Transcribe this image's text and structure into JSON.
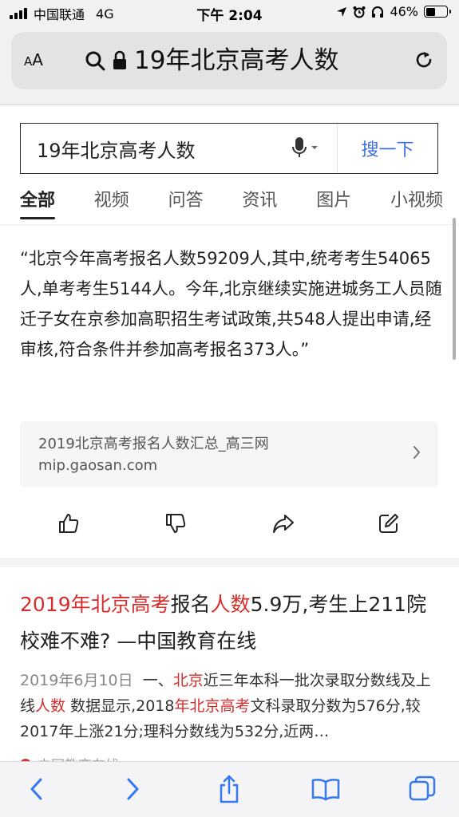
{
  "status_bar": {
    "carrier": "中国联通",
    "network": "4G",
    "time": "下午 2:04",
    "battery_percent": "46%",
    "battery_level": 0.46
  },
  "browser": {
    "text_size_label": "AA",
    "url_text": "19年北京高考人数",
    "icons": [
      "search-icon",
      "lock-icon",
      "reload-icon"
    ]
  },
  "search": {
    "query": "19年北京高考人数",
    "button_label": "搜一下"
  },
  "tabs": [
    {
      "label": "全部",
      "active": true
    },
    {
      "label": "视频"
    },
    {
      "label": "问答"
    },
    {
      "label": "资讯"
    },
    {
      "label": "图片"
    },
    {
      "label": "小视频"
    }
  ],
  "answer": {
    "text": "“北京今年高考报名人数59209人,其中,统考考生54065人,单考考生5144人。今年,北京继续实施进城务工人员随迁子女在京参加高职招生考试政策,共548人提出申请,经审核,符合条件并参加高考报名373人。”",
    "source_title": "2019北京高考报名人数汇总_高三网",
    "source_url": "mip.gaosan.com"
  },
  "actions": [
    "thumbs-up-icon",
    "thumbs-down-icon",
    "share-icon",
    "edit-icon"
  ],
  "result": {
    "title_parts": [
      {
        "text": "2019年北京高考",
        "hl": true
      },
      {
        "text": "报名",
        "hl": false
      },
      {
        "text": "人数",
        "hl": true
      },
      {
        "text": "5.9万,考生上211院校难不难? —中国教育在线",
        "hl": false
      }
    ],
    "date": "2019年6月10日",
    "desc_parts": [
      {
        "text": "一、",
        "hl": false
      },
      {
        "text": "北京",
        "hl": true
      },
      {
        "text": "近三年本科一批次录取分数线及上线",
        "hl": false
      },
      {
        "text": "人数",
        "hl": true
      },
      {
        "text": " 数据显示,2018",
        "hl": false
      },
      {
        "text": "年北京高考",
        "hl": true
      },
      {
        "text": "文科录取分数为576分,较2017年上涨21分;理科分数线为532分,近两…",
        "hl": false
      }
    ],
    "source_name": "中国教育在线"
  },
  "toolbar": [
    "back-icon",
    "forward-icon",
    "share-icon",
    "bookmarks-icon",
    "tabs-icon"
  ],
  "colors": {
    "highlight": "#d62d2d",
    "search_button": "#3b6fe0",
    "browser_chrome": "#f1f1f2"
  }
}
